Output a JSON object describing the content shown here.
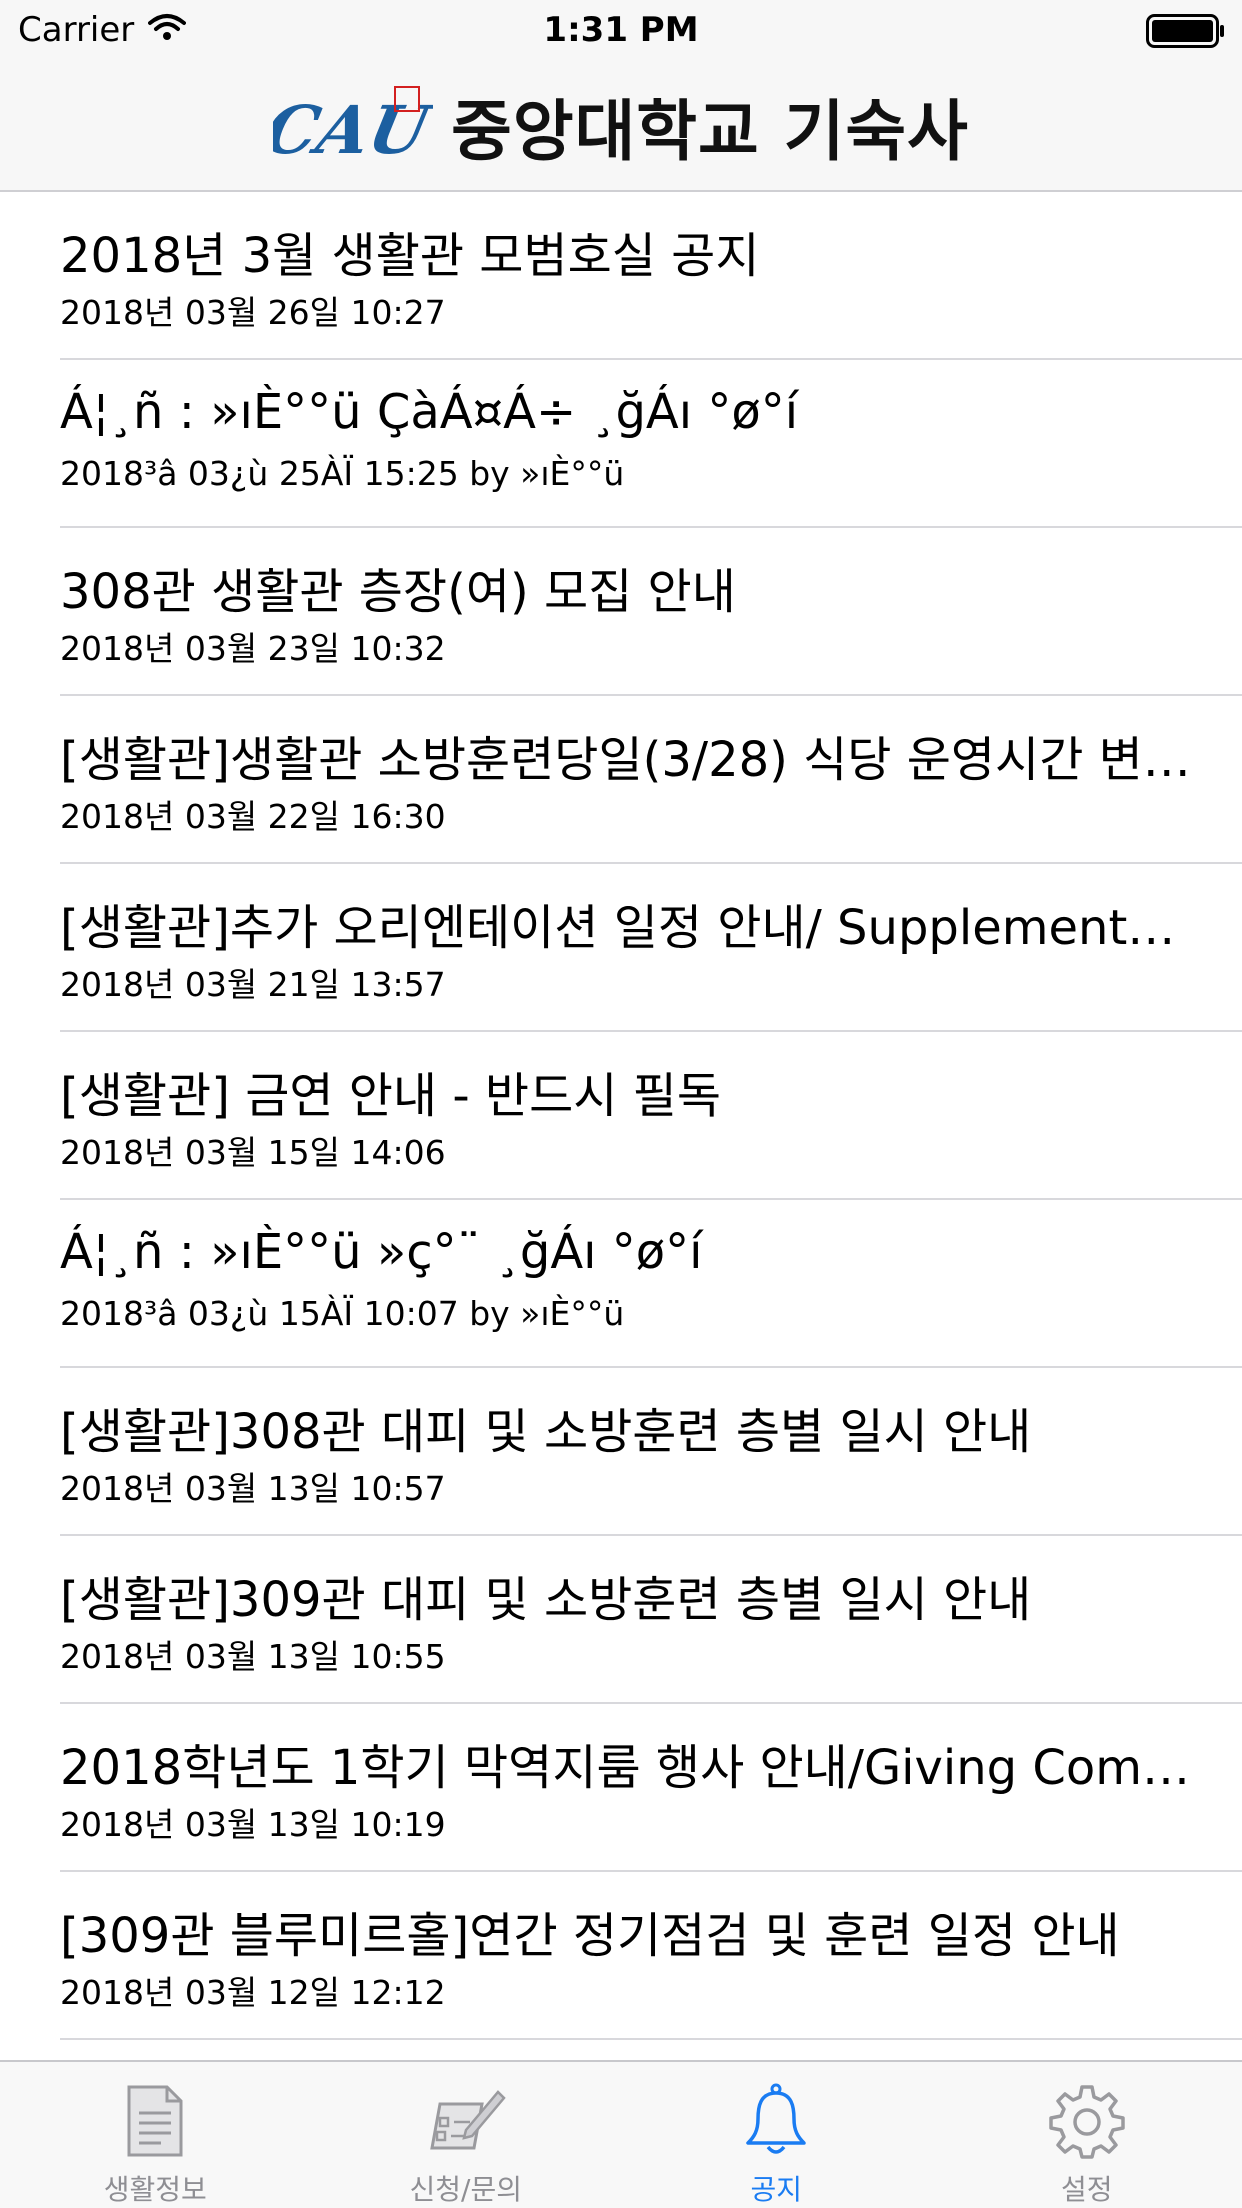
{
  "status_bar": {
    "carrier": "Carrier",
    "time": "1:31 PM"
  },
  "nav": {
    "logo_text": "CAU",
    "title": "중앙대학교 기숙사"
  },
  "notices": [
    {
      "title": "2018년 3월 생활관 모범호실 공지",
      "date": "2018년 03월 26일 10:27"
    },
    {
      "title": "Á¦¸ñ : »ıÈ°°ü ÇàÁ¤Á÷ ¸ğÁı °ø°í",
      "date": "2018³â 03¿ù 25ÀÏ 15:25 by »ıÈ°°ü"
    },
    {
      "title": "308관 생활관 층장(여) 모집 안내",
      "date": "2018년 03월 23일 10:32"
    },
    {
      "title": "[생활관]생활관 소방훈련당일(3/28) 식당 운영시간 변…",
      "date": "2018년 03월 22일 16:30"
    },
    {
      "title": "[생활관]추가 오리엔테이션 일정 안내/ Supplementa...",
      "date": "2018년 03월 21일 13:57"
    },
    {
      "title": "[생활관] 금연 안내 - 반드시 필독",
      "date": "2018년 03월 15일 14:06"
    },
    {
      "title": "Á¦¸ñ : »ıÈ°°ü »ç°¨ ¸ğÁı °ø°í",
      "date": "2018³â 03¿ù 15ÀÏ 10:07 by »ıÈ°°ü"
    },
    {
      "title": "[생활관]308관 대피 및 소방훈련 층별 일시 안내",
      "date": "2018년 03월 13일 10:57"
    },
    {
      "title": "[생활관]309관 대피 및 소방훈련 층별 일시 안내",
      "date": "2018년 03월 13일 10:55"
    },
    {
      "title": "2018학년도 1학기 막역지룸 행사 안내/Giving Comp...",
      "date": "2018년 03월 13일 10:19"
    },
    {
      "title": "[309관 블루미르홀]연간 정기점검 및 훈련 일정 안내",
      "date": "2018년 03월 12일 12:12"
    }
  ],
  "tabs": [
    {
      "label": "생활정보",
      "icon": "document-icon",
      "active": false
    },
    {
      "label": "신청/문의",
      "icon": "form-pen-icon",
      "active": false
    },
    {
      "label": "공지",
      "icon": "bell-icon",
      "active": true
    },
    {
      "label": "설정",
      "icon": "gear-icon",
      "active": false
    }
  ],
  "colors": {
    "accent": "#1a7cf2",
    "inactive_tab": "#8e8e93",
    "logo_blue": "#1c5fa0"
  }
}
